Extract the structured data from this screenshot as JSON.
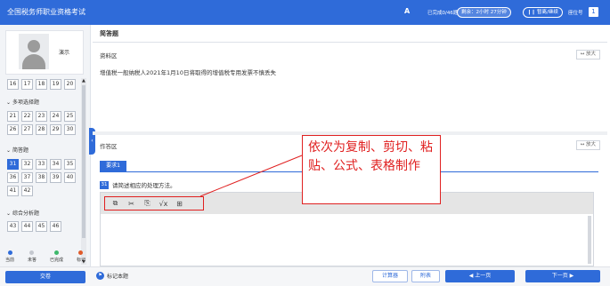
{
  "header": {
    "title": "全国税务师职业资格考试",
    "font_icon": "A",
    "answered": "已完成0/46题",
    "remaining": "剩余：2小时 27分钟",
    "pause": "❙❙ 暂离/继续",
    "seat_label": "座位号",
    "seat_number": "1"
  },
  "sidebar": {
    "username": "演示",
    "row_top": [
      "16",
      "17",
      "18",
      "19",
      "20"
    ],
    "section_multi": {
      "title": "多项选择题",
      "numbers": [
        "21",
        "22",
        "23",
        "24",
        "25",
        "26",
        "27",
        "28",
        "29",
        "30"
      ]
    },
    "section_short": {
      "title": "简答题",
      "numbers": [
        "31",
        "32",
        "33",
        "34",
        "35",
        "36",
        "37",
        "38",
        "39",
        "40",
        "41",
        "42"
      ],
      "current": "31"
    },
    "section_analysis": {
      "title": "综合分析题",
      "numbers": [
        "43",
        "44",
        "45",
        "46"
      ]
    },
    "legend": [
      {
        "label": "当前",
        "color": "#2f6bd9"
      },
      {
        "label": "未答",
        "color": "#c4c8cf"
      },
      {
        "label": "已完成",
        "color": "#3db86b"
      },
      {
        "label": "标记",
        "color": "#e05a2a"
      }
    ]
  },
  "main": {
    "question_type": "简答题",
    "material_title": "资料区",
    "enlarge": "↔ 放大",
    "material_text": "增值税一般纳税人2021年1月10日将取得的增值税专用发票不慎丢失",
    "answer_title": "作答区",
    "requirement_tab": "要求1",
    "question_number": "31",
    "question_text": "请简述相应的处理方法。",
    "tools": [
      {
        "name": "copy-icon",
        "glyph": "⧉"
      },
      {
        "name": "cut-icon",
        "glyph": "✂"
      },
      {
        "name": "paste-icon",
        "glyph": "⎘"
      },
      {
        "name": "formula-icon",
        "glyph": "√x"
      },
      {
        "name": "table-icon",
        "glyph": "⊞"
      }
    ]
  },
  "annotation": {
    "text": "依次为复制、剪切、粘贴、公式、表格制作",
    "color": "#e02020"
  },
  "footer": {
    "submit": "交卷",
    "mark": "标记本题",
    "calculator": "计算器",
    "appendix": "附表",
    "prev": "◀ 上一页",
    "next": "下一页 ▶"
  },
  "colors": {
    "primary": "#2f6bd9",
    "annotation": "#e02020"
  }
}
